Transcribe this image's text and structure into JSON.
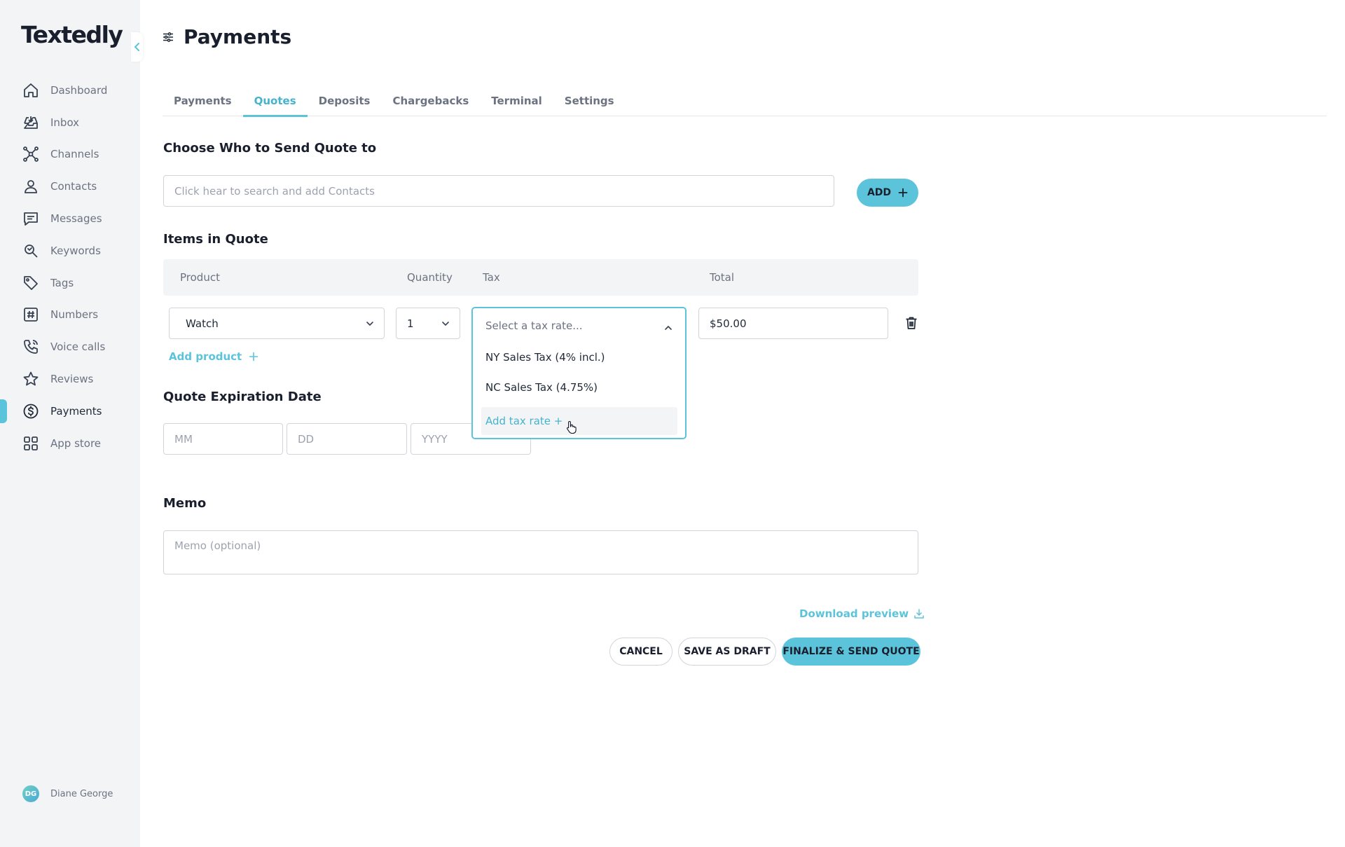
{
  "app": {
    "logo": "Textedly"
  },
  "sidebar": {
    "items": [
      {
        "label": "Dashboard",
        "icon": "home-icon"
      },
      {
        "label": "Inbox",
        "icon": "inbox-icon"
      },
      {
        "label": "Channels",
        "icon": "channels-icon"
      },
      {
        "label": "Contacts",
        "icon": "user-icon"
      },
      {
        "label": "Messages",
        "icon": "message-icon"
      },
      {
        "label": "Keywords",
        "icon": "keyword-icon"
      },
      {
        "label": "Tags",
        "icon": "tag-icon"
      },
      {
        "label": "Numbers",
        "icon": "hash-icon"
      },
      {
        "label": "Voice calls",
        "icon": "phone-icon"
      },
      {
        "label": "Reviews",
        "icon": "star-icon"
      },
      {
        "label": "Payments",
        "icon": "dollar-icon",
        "active": true
      },
      {
        "label": "App store",
        "icon": "grid-icon"
      }
    ],
    "user": {
      "initials": "DG",
      "name": "Diane George"
    }
  },
  "page": {
    "title": "Payments"
  },
  "tabs": [
    {
      "label": "Payments"
    },
    {
      "label": "Quotes",
      "active": true
    },
    {
      "label": "Deposits"
    },
    {
      "label": "Chargebacks"
    },
    {
      "label": "Terminal"
    },
    {
      "label": "Settings"
    }
  ],
  "recipients": {
    "title": "Choose Who to Send Quote to",
    "search_placeholder": "Click hear to search and add Contacts",
    "add_label": "ADD"
  },
  "items": {
    "title": "Items in Quote",
    "columns": {
      "product": "Product",
      "quantity": "Quantity",
      "tax": "Tax",
      "total": "Total"
    },
    "row": {
      "product": "Watch",
      "quantity": "1",
      "tax_placeholder": "Select a tax rate...",
      "total": "$50.00"
    },
    "add_product": "Add product",
    "tax_options": [
      "NY Sales Tax (4% incl.)",
      "NC Sales Tax (4.75%)"
    ],
    "add_tax_rate": "Add tax rate +"
  },
  "expiration": {
    "title": "Quote Expiration Date",
    "mm": "MM",
    "dd": "DD",
    "yyyy": "YYYY"
  },
  "memo": {
    "title": "Memo",
    "placeholder": "Memo (optional)"
  },
  "actions": {
    "download_preview": "Download preview",
    "cancel": "CANCEL",
    "save_draft": "SAVE AS DRAFT",
    "finalize": "FINALIZE & SEND QUOTE"
  },
  "colors": {
    "accent": "#5bc4db",
    "accent_text": "#45b3cd",
    "sidebar_bg": "#f3f4f6"
  }
}
